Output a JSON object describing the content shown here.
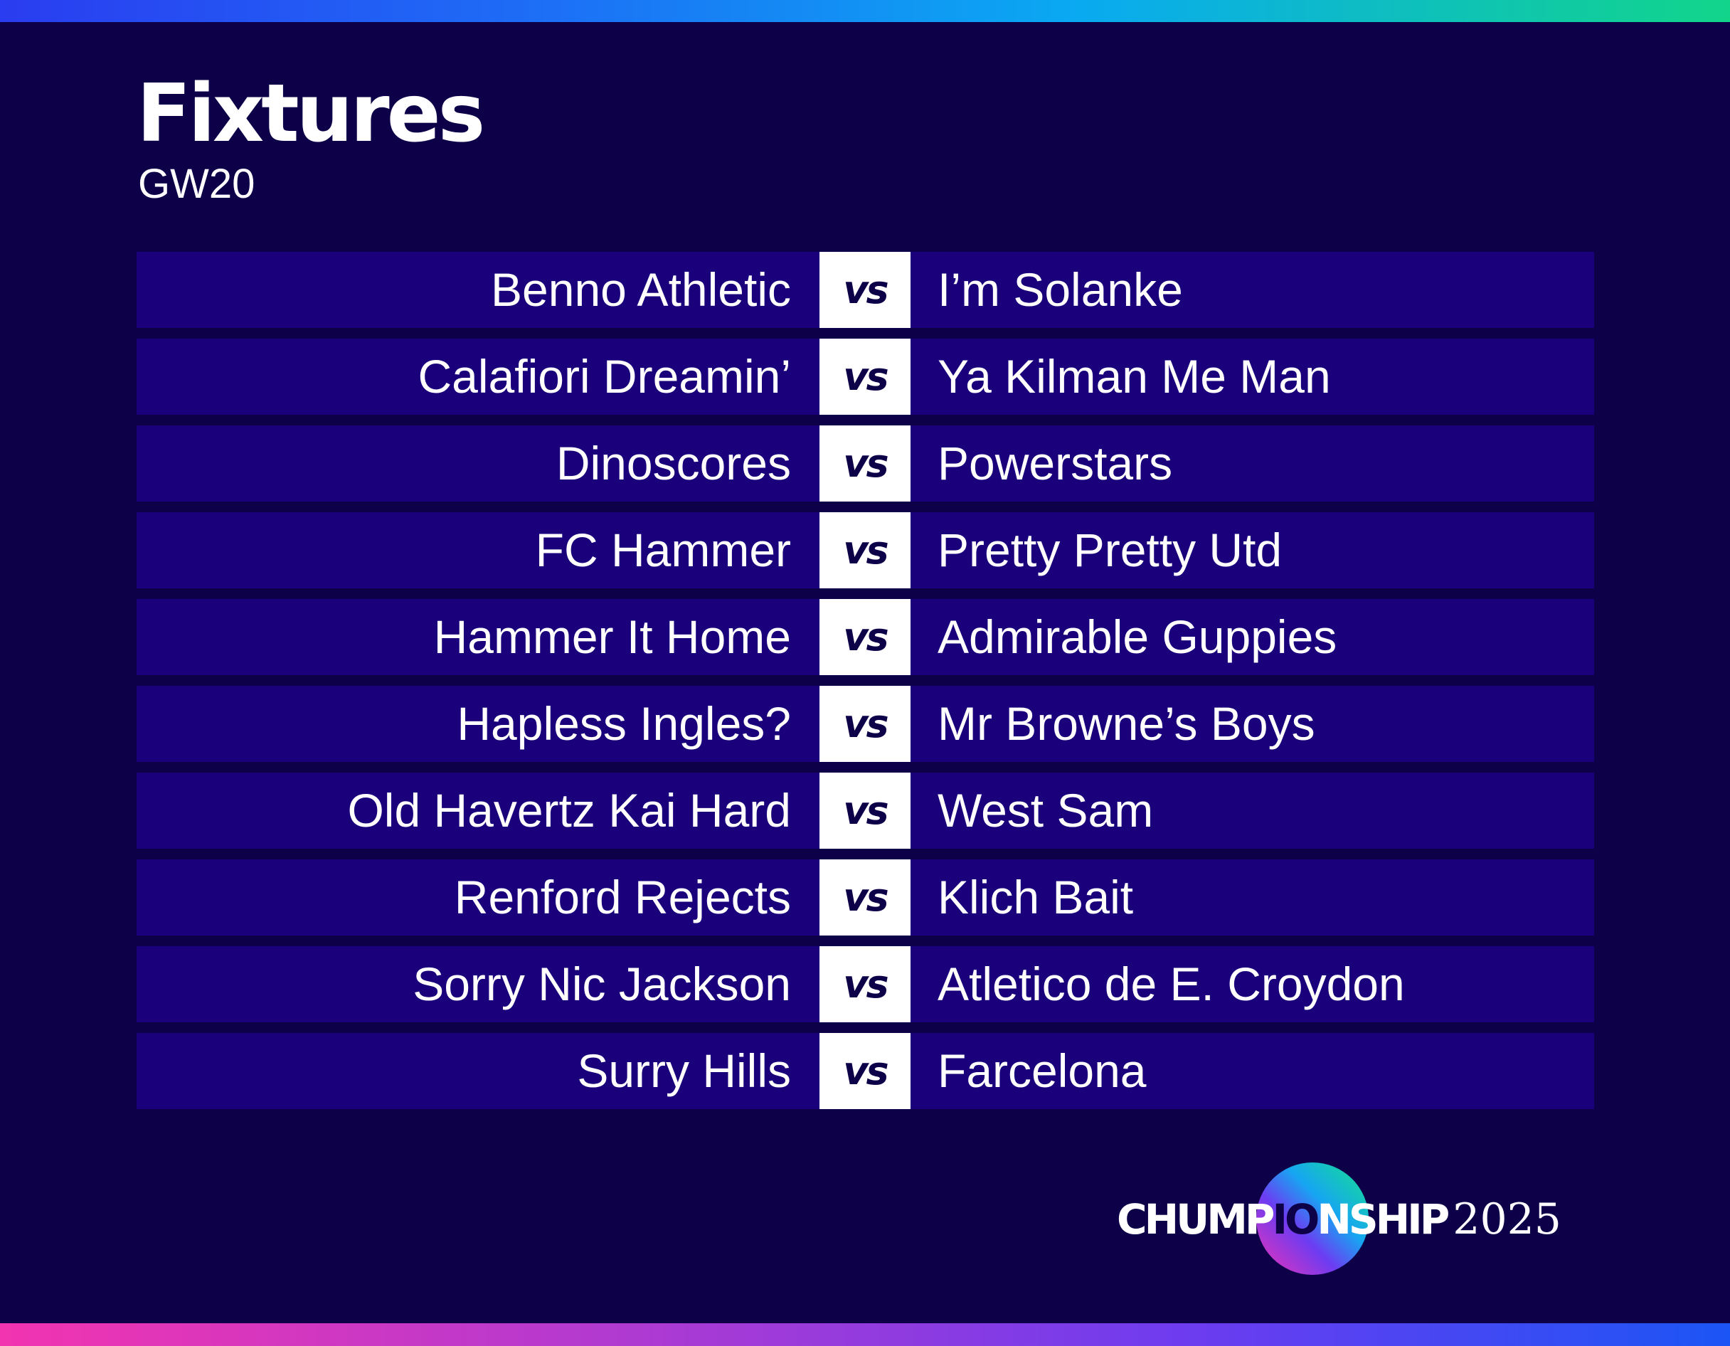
{
  "header": {
    "title": "Fixtures",
    "subtitle": "GW20"
  },
  "vs_label": "vs",
  "fixtures": [
    {
      "home": "Benno Athletic",
      "away": "I’m Solanke"
    },
    {
      "home": "Calafiori Dreamin’",
      "away": "Ya Kilman Me Man"
    },
    {
      "home": "Dinoscores",
      "away": "Powerstars"
    },
    {
      "home": "FC Hammer",
      "away": "Pretty Pretty Utd"
    },
    {
      "home": "Hammer It Home",
      "away": "Admirable Guppies"
    },
    {
      "home": "Hapless Ingles?",
      "away": "Mr Browne’s Boys"
    },
    {
      "home": "Old Havertz Kai Hard",
      "away": "West Sam"
    },
    {
      "home": "Renford Rejects",
      "away": "Klich Bait"
    },
    {
      "home": "Sorry Nic Jackson",
      "away": "Atletico de E. Croydon"
    },
    {
      "home": "Surry Hills",
      "away": "Farcelona"
    }
  ],
  "brand": {
    "name_start": "CHUMP",
    "name_middle": "IO",
    "name_end": "NSHIP",
    "year": "2025"
  },
  "colors": {
    "background": "#0d0049",
    "row_background": "#1a007a",
    "vs_background": "#ffffff",
    "text": "#ffffff"
  }
}
